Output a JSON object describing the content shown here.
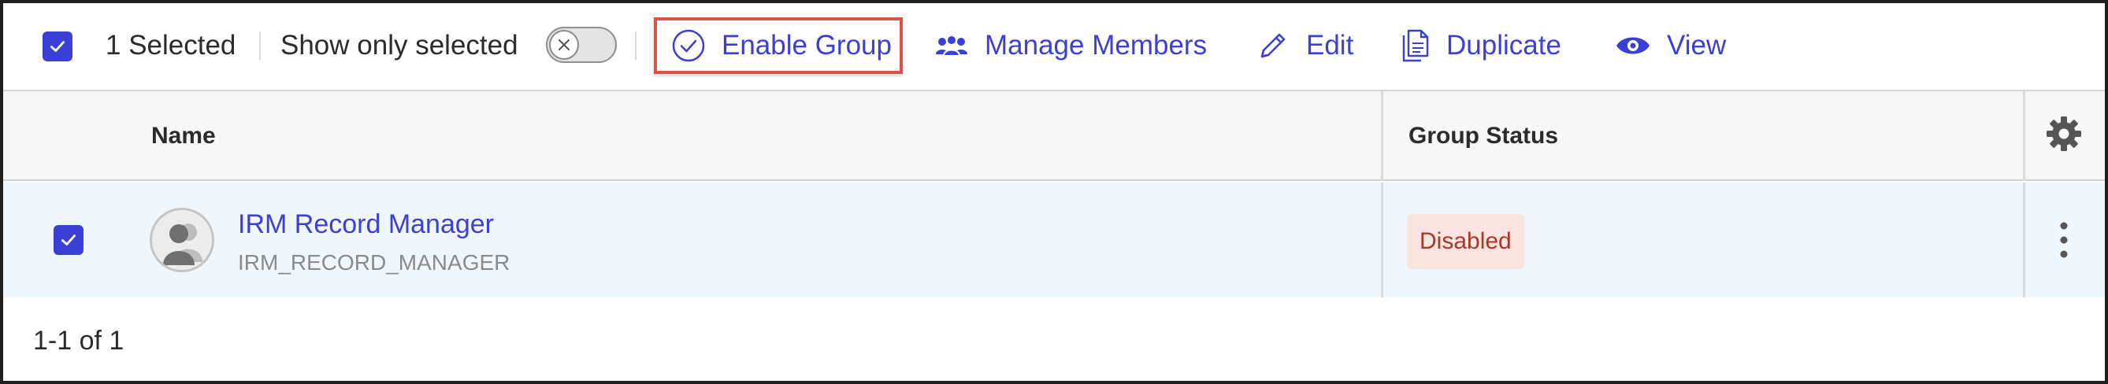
{
  "toolbar": {
    "selected_text": "1 Selected",
    "show_only_selected_label": "Show only selected",
    "toggle_on": false,
    "actions": {
      "enable_group": "Enable Group",
      "manage_members": "Manage Members",
      "edit": "Edit",
      "duplicate": "Duplicate",
      "view": "View"
    }
  },
  "table": {
    "columns": [
      "Name",
      "Group Status"
    ],
    "rows": [
      {
        "selected": true,
        "name": "IRM Record Manager",
        "code": "IRM_RECORD_MANAGER",
        "status": "Disabled"
      }
    ]
  },
  "pagination": {
    "text": "1-1 of 1"
  },
  "icons": {
    "header_checkbox": "checkbox-checked-icon",
    "toggle_knob": "x-icon",
    "enable_group": "check-circle-icon",
    "manage_members": "users-icon",
    "edit": "pencil-icon",
    "duplicate": "duplicate-icon",
    "view": "eye-icon",
    "settings": "gear-icon",
    "row_menu": "kebab-icon",
    "avatar": "group-avatar-icon"
  },
  "colors": {
    "accent": "#3a3fd6",
    "highlight_border": "#d9554a",
    "row_background": "#f0f7fc",
    "header_background": "#f7f7f7",
    "status_badge_bg": "#fbe4df",
    "status_badge_text": "#a33a24"
  }
}
